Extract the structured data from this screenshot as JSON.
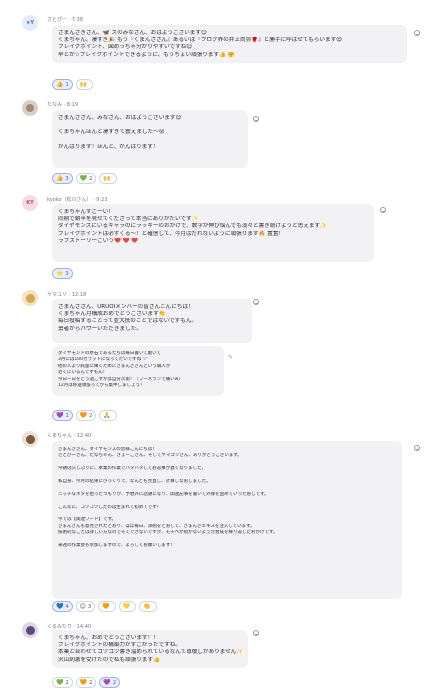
{
  "messages": [
    {
      "author": "さとぴー",
      "time": "7:38",
      "avatar_text": "★Y",
      "lines": [
        "さまんさきさん、🦋 ズのみなさん、おはようございます😊",
        "くまちゃん、凄すぎ🎉 もう『くまんささん』あるいは『ブログ界の井上尚弥🥊』と勝手に呼ばせてもらいます😍",
        "ブレイクポイント、図めっちゃ分かりやすいですね😊",
        "早とか☆ブレイクポイントできるように、もうちょい頑張ります👍 🤗"
      ],
      "reactions": [
        {
          "emoji": "👍",
          "count": "1",
          "active": true
        },
        {
          "emoji": "🙌",
          "count": "",
          "active": false
        }
      ]
    },
    {
      "author": "たなみ",
      "time": "8:19",
      "avatar_text": "",
      "lines": [
        "さまんささん、みなさん、おはようございます😊",
        "",
        "くまちゃんほんと凄すぎて震えました〜😵",
        "",
        "がんばります！ほんと、がんばります！"
      ],
      "reactions": [
        {
          "emoji": "👍",
          "count": "3",
          "active": true
        },
        {
          "emoji": "💚",
          "count": "2",
          "active": false
        },
        {
          "emoji": "🙌",
          "count": "",
          "active": false
        }
      ]
    },
    {
      "author": "kyoko（松川さん）",
      "time": "9:23",
      "avatar_text": "KY",
      "lines": [
        "くまちゃんすごーい！",
        "同期で朝半を見せてくださって本当にありがたいです✨",
        "ダイヤモンズにいるキャラのにラッキーのおかげで、数字が伸び悩んでも淡々と書き続けようと思えます✨",
        "ブレイクポイントは必ずくる〜！と確信して、今月はだれないように頑張ります🔥 置置！",
        "ラブストーリーごいう❤️ ❤️ ❤️"
      ],
      "reactions": [
        {
          "emoji": "⭐",
          "count": "3",
          "active": true
        }
      ]
    },
    {
      "author": "ヤマユリ",
      "time": "12:18",
      "avatar_text": "",
      "lines": [
        "さまんささん、URUOIメンバーの皆さんこんにちは！",
        "くまちゃん月構成おめでとうございます👏",
        "毎日投稿することって並大抵のことではないですもん。",
        "勇者からパワーいただきました。"
      ],
      "sub_lines": [
        "ダイヤモンドの原石であるたちは毎日書いて磨いて",
        "3月には100カラットになってたいですね 💎",
        "他の人より純量に輝くためにさまんささんという職人が",
        "近くにいるんですもん！",
        "今日ー日をどう過ごすかは自分次第！（プーメランで痛いw）",
        "12月は移送頑張ってがら集中しましょう！"
      ],
      "reactions": [
        {
          "emoji": "💜",
          "count": "1",
          "active": true
        },
        {
          "emoji": "🧡",
          "count": "2",
          "active": false
        },
        {
          "emoji": "🙏",
          "count": "",
          "active": false
        }
      ]
    },
    {
      "author": "くまちゃん",
      "time": "12:40",
      "avatar_text": "",
      "lines": [
        "さまんささん、ダイヤモンズの皆様こんにちは！",
        "さとぴーさん、たなちゃん、きょーこさん、そしてヤマユリさん、ありがとうございます。",
        "",
        "今朝は久しぶりに、本業の作業でバタバタしてお返事が遅くなりました。",
        "",
        "私自身、今月の結果にびっくりで、なんども見直し、計算しなおしました。",
        "",
        "ニッチなネタを拾ったつもりが、予想外に話題になり、関連記事を書いて外保を固めていった感じです。",
        "",
        "こんなに、コツコツしたのは生まれて初めてです！",
        "",
        "今では【関連ワード】です。",
        "さまんさんも意見されたとおり、ほぼ毎日、添削をとおして、さまんさエキスを注入しています。",
        "技術的なことは詳しい方なのでそくできないですが、モチベが続かないよう元会成を繰り返したおかげです。",
        "",
        "来週の作業会も参加しますので、よろしくお願いします！"
      ],
      "reactions": [
        {
          "emoji": "💙",
          "count": "4",
          "active": true
        },
        {
          "emoji": "😊",
          "count": "3",
          "active": false
        },
        {
          "emoji": "🧡",
          "count": "",
          "active": false
        },
        {
          "emoji": "💛",
          "count": "",
          "active": false
        },
        {
          "emoji": "👏",
          "count": "",
          "active": false
        }
      ]
    },
    {
      "author": "くるみたり",
      "time": "14:40",
      "avatar_text": "",
      "lines": [
        "くまちゃん、おめでとうございます！！",
        "ブレイクポイントの構築力がすごかったですね。",
        "本業と合わせてコツコツ書き溜められているなんて尊敬しかありません✨",
        "沢山刺激を受けたので私も頑張ります👍"
      ],
      "reactions": [
        {
          "emoji": "💚",
          "count": "2",
          "active": false
        },
        {
          "emoji": "🧡",
          "count": "2",
          "active": false
        },
        {
          "emoji": "💜",
          "count": "2",
          "active": true
        }
      ]
    }
  ]
}
